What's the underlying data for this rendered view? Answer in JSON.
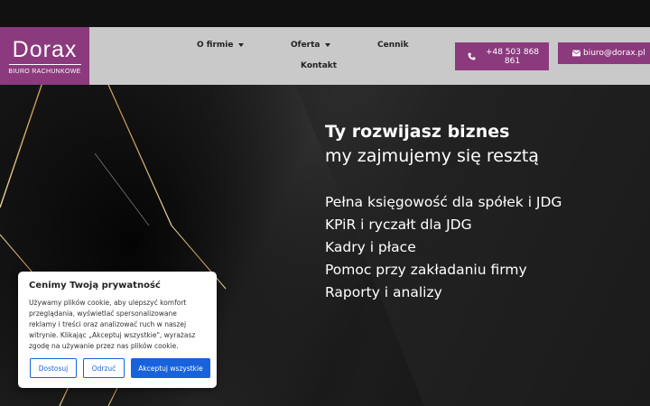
{
  "brand": {
    "name": "Dorax",
    "subtitle": "BIURO RACHUNKOWE",
    "accent": "#8b3a7d"
  },
  "nav": {
    "items": [
      {
        "label": "O firmie",
        "has_dropdown": true
      },
      {
        "label": "Oferta",
        "has_dropdown": true
      },
      {
        "label": "Cennik",
        "has_dropdown": false
      },
      {
        "label": "Kontakt",
        "has_dropdown": false
      }
    ]
  },
  "contact": {
    "phone": "+48 503 868 861",
    "phone_icon": "phone-icon",
    "email": "biuro@dorax.pl",
    "email_icon": "envelope-icon"
  },
  "hero": {
    "title": "Ty rozwijasz biznes",
    "subtitle": "my zajmujemy się resztą",
    "services": [
      "Pełna księgowość dla spółek i JDG",
      "KPiR i ryczałt dla JDG",
      "Kadry i płace",
      "Pomoc przy zakładaniu firmy",
      "Raporty i analizy"
    ]
  },
  "cookie": {
    "title": "Cenimy Twoją prywatność",
    "text": "Używamy plików cookie, aby ulepszyć komfort przeglądania, wyświetlać spersonalizowane reklamy i treści oraz analizować ruch w naszej witrynie. Klikając „Akceptuj wszystkie\", wyrażasz zgodę na używanie przez nas plików cookie.",
    "customize_label": "Dostosuj",
    "reject_label": "Odrzuć",
    "accept_label": "Akceptuj wszystkie",
    "button_color": "#1863dc"
  }
}
